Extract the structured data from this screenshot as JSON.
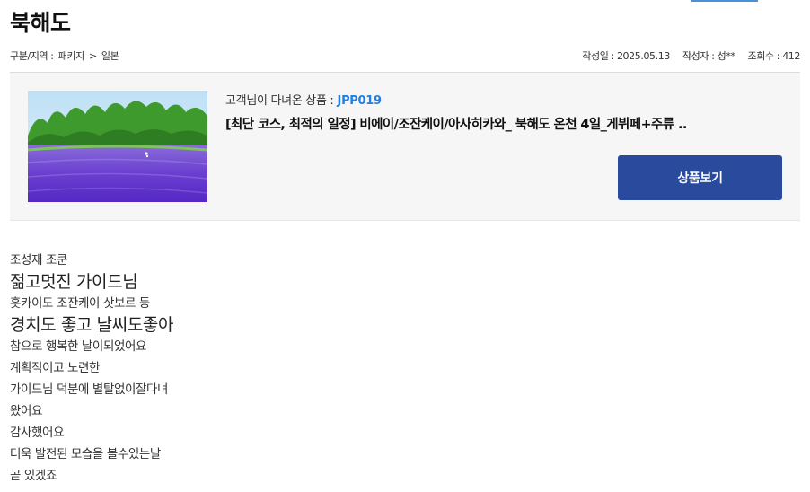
{
  "header": {
    "title": "북해도"
  },
  "meta": {
    "breadcrumb": [
      "구분/지역 :",
      "패키지",
      ">",
      "일본"
    ],
    "date": "작성일 : 2025.05.13",
    "author": "작성자 : 성**",
    "views": "조회수 : 412"
  },
  "product": {
    "visited_label": "고객님이 다녀온 상품 :",
    "code": "JPP019",
    "name": "[최단 코스, 최적의 일정] 비에이/조잔케이/아사히카와_ 북해도 온천 4일_게뷔페+주류 ..",
    "button_label": "상품보기"
  },
  "review": {
    "lines": [
      "조성재  조쿤",
      "젊고멋진 가이드님",
      "홋카이도 조잔케이  삿보르 등",
      "경치도 좋고 날씨도좋아",
      "참으로 행복한 날이되었어요",
      "계획적이고 노련한",
      "가이드님 덕분에 별탈없이잘다녀",
      "왔어요",
      "감사했어요",
      "더욱 발전된 모습을 볼수있는날",
      "곧 있겠죠"
    ]
  }
}
